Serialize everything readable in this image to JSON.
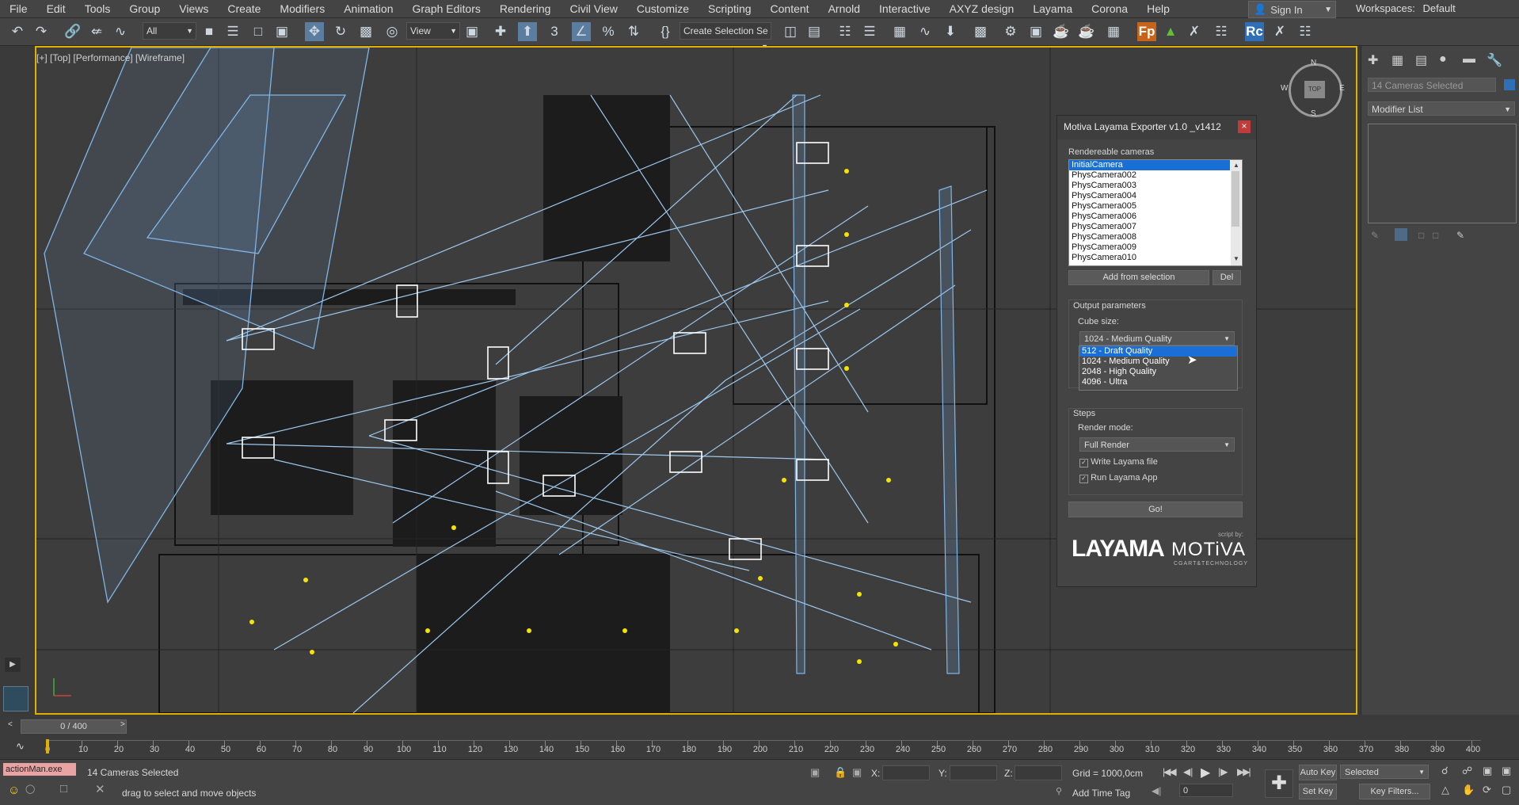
{
  "menu": [
    "File",
    "Edit",
    "Tools",
    "Group",
    "Views",
    "Create",
    "Modifiers",
    "Animation",
    "Graph Editors",
    "Rendering",
    "Civil View",
    "Customize",
    "Scripting",
    "Content",
    "Arnold",
    "Interactive",
    "AXYZ design",
    "Layama",
    "Corona",
    "Help"
  ],
  "signin": {
    "label": "Sign In"
  },
  "workspaces": {
    "label": "Workspaces:",
    "value": "Default"
  },
  "toolbar": {
    "filter": "All",
    "refcoord": "View",
    "selection_set": "Create Selection Se"
  },
  "viewport": {
    "label": "[+] [Top] [Performance] [Wireframe]"
  },
  "viewcube": {
    "face": "TOP",
    "n": "N",
    "s": "S",
    "e": "E",
    "w": "W"
  },
  "dialog": {
    "title": "Motiva Layama Exporter v1.0 _v1412",
    "close": "×",
    "cameras_label": "Rendereable cameras",
    "cameras": [
      "InitialCamera",
      "PhysCamera002",
      "PhysCamera003",
      "PhysCamera004",
      "PhysCamera005",
      "PhysCamera006",
      "PhysCamera007",
      "PhysCamera008",
      "PhysCamera009",
      "PhysCamera010"
    ],
    "add_button": "Add from selection",
    "del_button": "Del",
    "output_label": "Output parameters",
    "cube_label": "Cube size:",
    "cube_value": "1024 - Medium Quality",
    "cube_options": [
      "512 - Draft Quality",
      "1024 - Medium Quality",
      "2048 - High Quality",
      "4096 - Ultra"
    ],
    "steps_label": "Steps",
    "render_label": "Render mode:",
    "render_value": "Full Render",
    "write_label": "Write Layama file",
    "run_label": "Run Layama App",
    "go_button": "Go!",
    "logo_left": "LAYAMA",
    "logo_right": "MOTiVA",
    "logo_right_sub": "CGART&TECHNOLOGY",
    "logo_script": "script by:"
  },
  "right_panel": {
    "name_field": "14 Cameras Selected",
    "modifier_list": "Modifier List"
  },
  "timeline": {
    "frame": "0 / 400",
    "ticks": [
      "0",
      "10",
      "20",
      "30",
      "40",
      "50",
      "60",
      "70",
      "80",
      "90",
      "100",
      "110",
      "120",
      "130",
      "140",
      "150",
      "160",
      "170",
      "180",
      "190",
      "200",
      "210",
      "220",
      "230",
      "240",
      "250",
      "260",
      "270",
      "280",
      "290",
      "300",
      "310",
      "320",
      "330",
      "340",
      "350",
      "360",
      "370",
      "380",
      "390",
      "400"
    ]
  },
  "status": {
    "listener": "actionMan.exe",
    "selected": "14 Cameras Selected",
    "prompt": "drag to select and move objects",
    "x_label": "X:",
    "y_label": "Y:",
    "z_label": "Z:",
    "grid": "Grid = 1000,0cm",
    "add_time_tag": "Add Time Tag",
    "auto_key": "Auto Key",
    "set_key": "Set Key",
    "key_mode": "Selected",
    "key_filters": "Key Filters...",
    "frame_field": "0"
  }
}
